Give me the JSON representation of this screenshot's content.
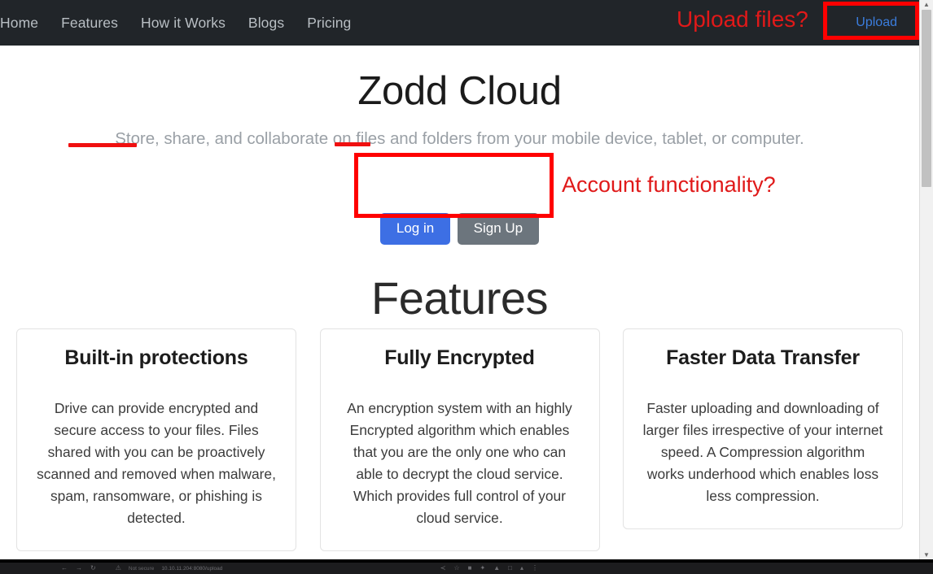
{
  "navbar": {
    "links": [
      {
        "label": "Home"
      },
      {
        "label": "Features"
      },
      {
        "label": "How it Works"
      },
      {
        "label": "Blogs"
      },
      {
        "label": "Pricing"
      }
    ],
    "upload_label": "Upload",
    "background_color": "#212529",
    "link_color": "#b9bfc4",
    "upload_color": "#3b7ddd"
  },
  "hero": {
    "title": "Zodd Cloud",
    "subtitle": "Store, share, and collaborate on files and folders from your mobile device, tablet, or computer.",
    "login_label": "Log in",
    "signup_label": "Sign Up",
    "login_color": "#3d6fe4",
    "signup_color": "#6c757d"
  },
  "features": {
    "heading": "Features",
    "cards": [
      {
        "title": "Built-in protections",
        "body": "Drive can provide encrypted and secure access to your files. Files shared with you can be proactively scanned and removed when malware, spam, ransomware, or phishing is detected."
      },
      {
        "title": "Fully Encrypted",
        "body": "An encryption system with an highly Encrypted algorithm which enables that you are the only one who can able to decrypt the cloud service. Which provides full control of your cloud service."
      },
      {
        "title": "Faster Data Transfer",
        "body": "Faster uploading and downloading of larger files irrespective of your internet speed. A Compression algorithm works underhood which enables loss less compression."
      }
    ]
  },
  "annotations": {
    "color": "#ff0000",
    "upload_question": "Upload files?",
    "account_question": "Account functionality?"
  },
  "scrollbar": {
    "up_arrow": "▲",
    "down_arrow": "▼"
  },
  "browser_sliver": {
    "back_icon": "←",
    "forward_icon": "→",
    "reload_icon": "↻",
    "warning_icon": "⚠",
    "not_secure_label": "Not secure",
    "url": "10.10.11.204:8080/upload",
    "share_icon": "≺",
    "star_icon": "☆",
    "puzzle_icon": "■",
    "extension_icon": "✦",
    "person_icon": "▲",
    "window_icon": "□",
    "profile_icon": "▴",
    "menu_icon": "⋮"
  }
}
